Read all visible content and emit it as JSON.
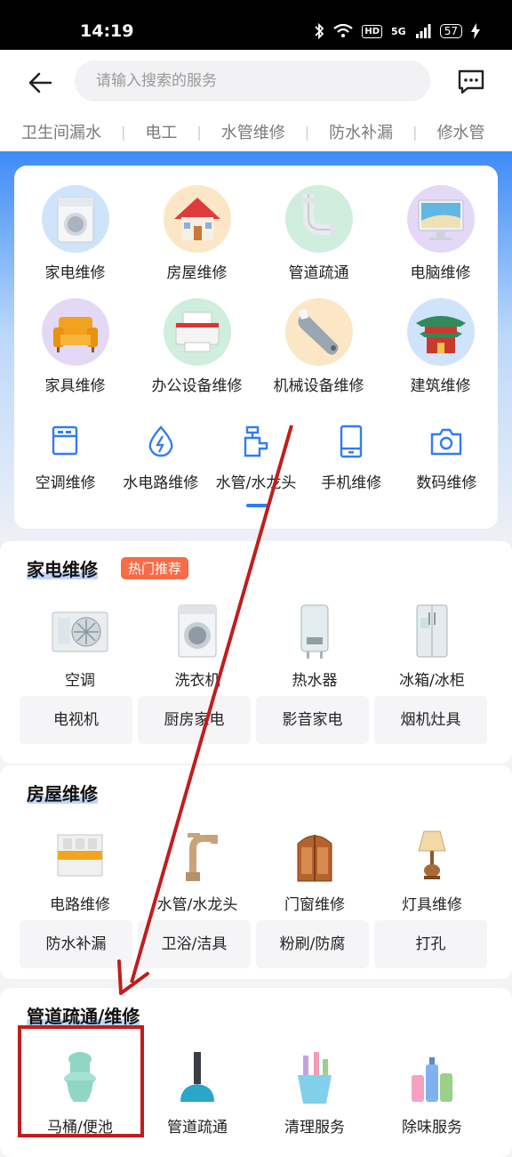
{
  "status_bar": {
    "time": "14:19",
    "hd": "HD",
    "network": "5G",
    "battery": "57"
  },
  "search": {
    "placeholder": "请输入搜索的服务"
  },
  "hot_tags": [
    "卫生间漏水",
    "电工",
    "水管维修",
    "防水补漏",
    "修水管"
  ],
  "categories": [
    {
      "label": "家电维修",
      "icon": "washing-machine-icon",
      "color": "#cfe3fb"
    },
    {
      "label": "房屋维修",
      "icon": "house-icon",
      "color": "#fbe7c6"
    },
    {
      "label": "管道疏通",
      "icon": "pipe-icon",
      "color": "#cfeedd"
    },
    {
      "label": "电脑维修",
      "icon": "computer-icon",
      "color": "#e3d9f7"
    },
    {
      "label": "家具维修",
      "icon": "sofa-icon",
      "color": "#e3d9f7"
    },
    {
      "label": "办公设备维修",
      "icon": "printer-icon",
      "color": "#cfeedd"
    },
    {
      "label": "机械设备维修",
      "icon": "wrench-icon",
      "color": "#fbe7c6"
    },
    {
      "label": "建筑维修",
      "icon": "pavilion-icon",
      "color": "#cfe3fb"
    }
  ],
  "small_categories": [
    {
      "label": "空调维修",
      "icon": "air-conditioner-icon"
    },
    {
      "label": "水电路维修",
      "icon": "water-drop-icon"
    },
    {
      "label": "水管/水龙头",
      "icon": "faucet-icon"
    },
    {
      "label": "手机维修",
      "icon": "phone-icon"
    },
    {
      "label": "数码维修",
      "icon": "camera-icon"
    }
  ],
  "sections": {
    "appliance": {
      "title": "家电维修",
      "badge": "热门推荐",
      "items": [
        {
          "label": "空调",
          "icon": "ac-unit-icon"
        },
        {
          "label": "洗衣机",
          "icon": "washer-icon"
        },
        {
          "label": "热水器",
          "icon": "water-heater-icon"
        },
        {
          "label": "冰箱/冰柜",
          "icon": "fridge-icon"
        }
      ],
      "chips": [
        "电视机",
        "厨房家电",
        "影音家电",
        "烟机灶具"
      ]
    },
    "house": {
      "title": "房屋维修",
      "items": [
        {
          "label": "电路维修",
          "icon": "breaker-icon"
        },
        {
          "label": "水管/水龙头",
          "icon": "tap-icon"
        },
        {
          "label": "门窗维修",
          "icon": "door-icon"
        },
        {
          "label": "灯具维修",
          "icon": "lamp-icon"
        }
      ],
      "chips": [
        "防水补漏",
        "卫浴/洁具",
        "粉刷/防腐",
        "打孔"
      ]
    },
    "pipe": {
      "title": "管道疏通/维修",
      "items": [
        {
          "label": "马桶/便池",
          "icon": "toilet-icon"
        },
        {
          "label": "管道疏通",
          "icon": "plunger-icon"
        },
        {
          "label": "清理服务",
          "icon": "cleaning-bucket-icon"
        },
        {
          "label": "除味服务",
          "icon": "bottles-icon"
        }
      ]
    }
  },
  "colors": {
    "accent": "#2f7cf6",
    "badge": "#f76b46",
    "annotation": "#c11d1d"
  }
}
